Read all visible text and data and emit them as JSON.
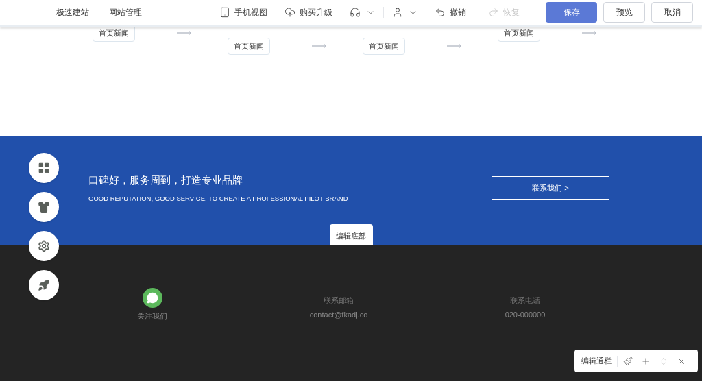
{
  "header": {
    "left_links": [
      "极速建站",
      "网站管理"
    ],
    "tools": [
      {
        "kind": "tablet",
        "label": "手机视图",
        "disabled": false
      },
      {
        "kind": "cloud",
        "label": "购买升级",
        "disabled": false
      },
      {
        "kind": "headset",
        "disabled": false
      },
      {
        "kind": "user",
        "disabled": false
      },
      {
        "kind": "undo",
        "label": "撤销",
        "disabled": false
      },
      {
        "kind": "redo",
        "label": "恢复",
        "disabled": true
      }
    ],
    "buttons": [
      {
        "label": "保存",
        "primary": true
      },
      {
        "label": "预览",
        "primary": false
      },
      {
        "label": "取消",
        "primary": false
      }
    ]
  },
  "steps": [
    {
      "button": "首页新闻",
      "raised": true
    },
    {
      "button": "首页新闻",
      "raised": false
    },
    {
      "button": "首页新闻",
      "raised": false
    },
    {
      "button": "首页新闻",
      "raised": true
    }
  ],
  "banner": {
    "title": "口碑好，服务周到，打造专业品牌",
    "subtitle": "GOOD REPUTATION, GOOD SERVICE, TO CREATE A PROFESSIONAL PILOT BRAND",
    "contact_button": "联系我们 >",
    "edit_button": "编辑底部"
  },
  "floating_buttons": [
    {
      "kind": "widgets"
    },
    {
      "kind": "shirt"
    },
    {
      "kind": "settings"
    },
    {
      "kind": "rocket"
    }
  ],
  "footer": {
    "columns": [
      {
        "kind": "wechat",
        "label": "关注我们"
      },
      {
        "kind": "text",
        "title": "联系邮箱",
        "value": "contact@fkadj.co"
      },
      {
        "kind": "text",
        "title": "联系电话",
        "value": "020-000000"
      }
    ]
  },
  "section_toolbar": {
    "label": "编辑通栏",
    "actions": [
      {
        "kind": "style",
        "disabled": false
      },
      {
        "kind": "add",
        "disabled": false
      },
      {
        "kind": "move",
        "disabled": true
      },
      {
        "kind": "close",
        "disabled": false
      }
    ]
  }
}
